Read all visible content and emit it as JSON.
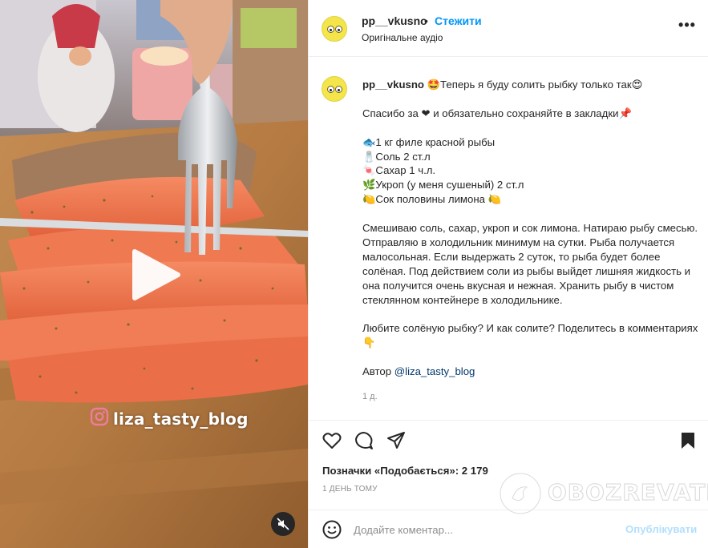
{
  "post": {
    "username": "pp__vkusno",
    "separator": "•",
    "follow_label": "Стежити",
    "audio_label": "Оригінальне аудіо",
    "more_icon": "more-dots-icon"
  },
  "caption": {
    "username": "pp__vkusno",
    "lines": [
      "🤩Теперь я буду солить рыбку только так😍",
      "",
      "Спасибо за ❤ и обязательно сохраняйте в закладки📌",
      "",
      "🐟1 кг филе красной рыбы",
      "🧂Соль 2 ст.л",
      "🍬Сахар 1 ч.л.",
      "🌿Укроп (у меня сушеный) 2 ст.л",
      "🍋Сок половины лимона 🍋",
      "",
      "Смешиваю соль, сахар, укроп и сок лимона. Натираю рыбу смесью. Отправляю в холодильник минимум на сутки. Рыба получается малосольная. Если выдержать 2 суток, то рыба будет более солёная. Под действием соли из рыбы выйдет лишняя жидкость и она получится очень вкусная и нежная. Хранить рыбу в чистом стеклянном контейнере в холодильнике.",
      "",
      "Любите солёную рыбку? И как солите? Поделитесь в комментариях👇"
    ],
    "author_prefix": "Автор ",
    "author_link": "@liza_tasty_blog",
    "age": "1 д."
  },
  "media": {
    "watermark": "liza_tasty_blog"
  },
  "actions": {
    "likes_text": "Позначки «Подобається»: 2 179",
    "date": "1 ДЕНЬ ТОМУ"
  },
  "comment": {
    "placeholder": "Додайте коментар...",
    "publish_label": "Опублікувати"
  },
  "watermark": {
    "brand": "OBOZREVATEL"
  },
  "colors": {
    "accent": "#0095f6",
    "link": "#00376b",
    "muted": "#8e8e8e",
    "publish_disabled": "#b2dffc"
  }
}
